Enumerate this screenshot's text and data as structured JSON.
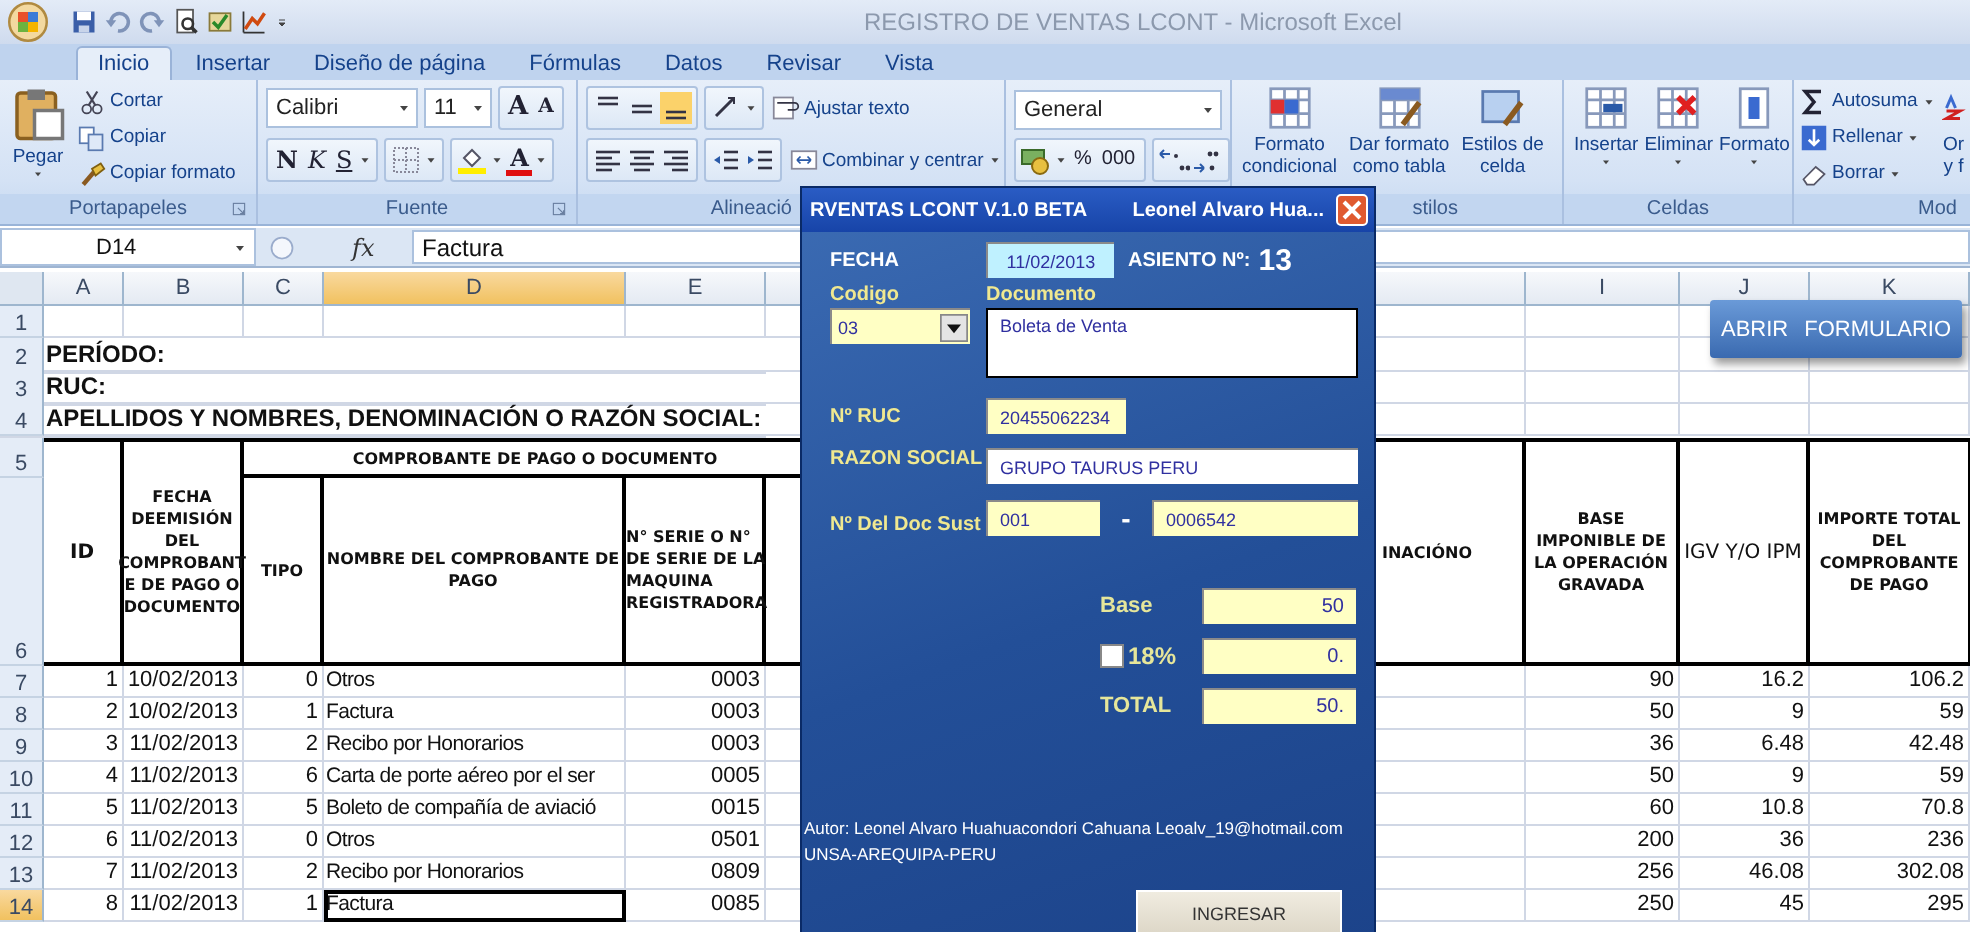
{
  "window": {
    "title": "REGISTRO DE VENTAS LCONT - Microsoft Excel"
  },
  "ribbon_tabs": [
    {
      "label": "Inicio",
      "selected": true
    },
    {
      "label": "Insertar",
      "selected": false
    },
    {
      "label": "Diseño de página",
      "selected": false
    },
    {
      "label": "Fórmulas",
      "selected": false
    },
    {
      "label": "Datos",
      "selected": false
    },
    {
      "label": "Revisar",
      "selected": false
    },
    {
      "label": "Vista",
      "selected": false
    }
  ],
  "ribbon": {
    "clipboard": {
      "paste": "Pegar",
      "cut": "Cortar",
      "copy": "Copiar",
      "format_painter": "Copiar formato",
      "label": "Portapapeles"
    },
    "font": {
      "family": "Calibri",
      "size": "11",
      "grow": "A",
      "shrink": "A",
      "bold": "N",
      "italic": "K",
      "underline": "S",
      "font_color_label": "A",
      "label": "Fuente"
    },
    "alignment": {
      "wrap": "Ajustar texto",
      "merge": "Combinar y centrar",
      "label": "Alineació"
    },
    "number": {
      "format": "General",
      "percent": "%",
      "thousands": "000"
    },
    "styles": {
      "conditional": [
        "Formato",
        "condicional"
      ],
      "table": [
        "Dar formato",
        "como tabla"
      ],
      "cell_styles": [
        "Estilos de",
        "celda"
      ],
      "label": "stilos"
    },
    "cells": {
      "insert": "Insertar",
      "delete": "Eliminar",
      "format": "Formato",
      "label": "Celdas"
    },
    "editing": {
      "autosum": "Autosuma",
      "fill": "Rellenar",
      "clear": "Borrar",
      "sort": [
        "Or",
        "y f"
      ],
      "label": "Mod"
    }
  },
  "formula_bar": {
    "cell": "D14",
    "function_label": "fx",
    "value": "Factura"
  },
  "sheet": {
    "columns": [
      {
        "label": "A",
        "selected": false
      },
      {
        "label": "B",
        "selected": false
      },
      {
        "label": "C",
        "selected": false
      },
      {
        "label": "D",
        "selected": true
      },
      {
        "label": "E",
        "selected": false
      },
      {
        "label": "I",
        "selected": false
      },
      {
        "label": "J",
        "selected": false
      },
      {
        "label": "K",
        "selected": false
      }
    ],
    "top_rows": [
      {
        "number": "1"
      },
      {
        "number": "2",
        "text": "PERÍODO:"
      },
      {
        "number": "3",
        "text": "RUC:"
      },
      {
        "number": "4",
        "text": "APELLIDOS Y NOMBRES, DENOMINACIÓN O RAZÓN SOCIAL:"
      }
    ],
    "header": {
      "row_numbers": [
        "5",
        "6"
      ],
      "group": "COMPROBANTE DE PAGO O DOCUMENTO",
      "id": "ID",
      "date": "FECHA DEEMISIÓN DEL COMPROBANT E DE PAGO O DOCUMENTO",
      "type": "TIPO",
      "name": "NOMBRE DEL COMPROBANTE DE PAGO",
      "series": "N° SERIE O N° DE SERIE DE LA MAQUINA REGISTRADORA",
      "column_h": "INACIÓNO",
      "base": "BASE IMPONIBLE DE LA OPERACIÓN GRAVADA",
      "tax": "IGV Y/O IPM",
      "total": "IMPORTE TOTAL DEL COMPROBANTE DE PAGO"
    },
    "rows": [
      {
        "number": "7",
        "selected": false,
        "cells": [
          "1",
          "10/02/2013",
          "0",
          "Otros",
          "0003",
          "90",
          "16.2",
          "106.2"
        ]
      },
      {
        "number": "8",
        "selected": false,
        "cells": [
          "2",
          "10/02/2013",
          "1",
          "Factura",
          "0003",
          "50",
          "9",
          "59"
        ]
      },
      {
        "number": "9",
        "selected": false,
        "cells": [
          "3",
          "11/02/2013",
          "2",
          "Recibo por Honorarios",
          "0003",
          "36",
          "6.48",
          "42.48"
        ]
      },
      {
        "number": "10",
        "selected": false,
        "cells": [
          "4",
          "11/02/2013",
          "6",
          "Carta de porte aéreo por el ser",
          "0005",
          "50",
          "9",
          "59"
        ]
      },
      {
        "number": "11",
        "selected": false,
        "cells": [
          "5",
          "11/02/2013",
          "5",
          "Boleto de compañía de aviació",
          "0015",
          "60",
          "10.8",
          "70.8"
        ]
      },
      {
        "number": "12",
        "selected": false,
        "cells": [
          "6",
          "11/02/2013",
          "0",
          "Otros",
          "0501",
          "200",
          "36",
          "236"
        ]
      },
      {
        "number": "13",
        "selected": false,
        "cells": [
          "7",
          "11/02/2013",
          "2",
          "Recibo por Honorarios",
          "0809",
          "256",
          "46.08",
          "302.08"
        ]
      },
      {
        "number": "14",
        "selected": true,
        "cells": [
          "8",
          "11/02/2013",
          "1",
          "Factura",
          "0085",
          "250",
          "45",
          "295"
        ]
      }
    ],
    "button": {
      "label": "ABRIR FORMULARIO"
    }
  },
  "dialog": {
    "title": "RVENTAS LCONT V.1.0  BETA",
    "author_title": "Leonel Alvaro Hua...",
    "date_label": "FECHA",
    "date": "11/02/2013",
    "entry_label": "ASIENTO Nº:",
    "entry_number": "13",
    "code_label": "Codigo",
    "code": "03",
    "document_label": "Documento",
    "document": "Boleta de Venta",
    "ruc_label": "Nº RUC",
    "ruc": "20455062234",
    "company_label": "RAZON SOCIAL",
    "company": "GRUPO TAURUS PERU",
    "doc_label": "Nº Del Doc Sust",
    "doc_series": "001",
    "doc_separator": "-",
    "doc_number": "0006542",
    "base_label": "Base",
    "base": "50",
    "tax": {
      "label": "18%",
      "checked": false,
      "value": "0."
    },
    "total_label": "TOTAL",
    "total": "50.",
    "author": "Autor: Leonel Alvaro Huahuacondori Cahuana Leoalv_19@hotmail.com",
    "location": "UNSA-AREQUIPA-PERU",
    "submit": "INGRESAR"
  }
}
